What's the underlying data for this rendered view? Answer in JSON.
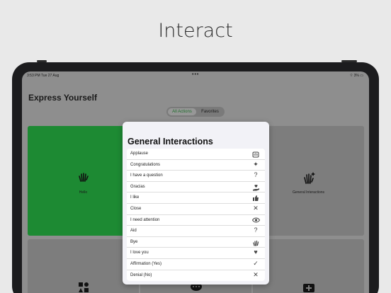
{
  "headline": "Interact",
  "status": {
    "time": "3:53 PM  Tue 27 Aug",
    "dots": "•••",
    "right": "⌔ 3% ▭"
  },
  "title": "Express Yourself",
  "segmented": {
    "options": [
      "All Actions",
      "Favorites"
    ],
    "selected": "All Actions"
  },
  "accent": "#1d8a33",
  "cards": [
    {
      "label": "Hello",
      "icon": "✋",
      "icon_name": "waving-hand-icon"
    },
    {
      "label": "General Interactions",
      "icon": "✋",
      "icon_name": "hand-sparkle-icon"
    }
  ],
  "popup": {
    "title": "General Interactions",
    "items": [
      {
        "label": "Applause",
        "icon": "👏",
        "icon_name": "applause-icon"
      },
      {
        "label": "Congratulations",
        "icon": "✦",
        "icon_name": "sparkles-icon"
      },
      {
        "label": "I have a question",
        "icon": "?",
        "icon_name": "question-icon"
      },
      {
        "label": "Gracias",
        "icon": "♡",
        "icon_name": "hand-heart-icon"
      },
      {
        "label": "I like",
        "icon": "👍",
        "icon_name": "thumbs-up-icon"
      },
      {
        "label": "Close",
        "icon": "✕",
        "icon_name": "close-icon"
      },
      {
        "label": "I need attention",
        "icon": "◉",
        "icon_name": "eye-icon"
      },
      {
        "label": "Aid",
        "icon": "?",
        "icon_name": "question-icon"
      },
      {
        "label": "Bye",
        "icon": "✋",
        "icon_name": "wave-icon"
      },
      {
        "label": "I love you",
        "icon": "♥",
        "icon_name": "heart-icon"
      },
      {
        "label": "Affirmation (Yes)",
        "icon": "✓",
        "icon_name": "checkmark-icon"
      },
      {
        "label": "Denial (No)",
        "icon": "✕",
        "icon_name": "x-icon"
      }
    ]
  }
}
